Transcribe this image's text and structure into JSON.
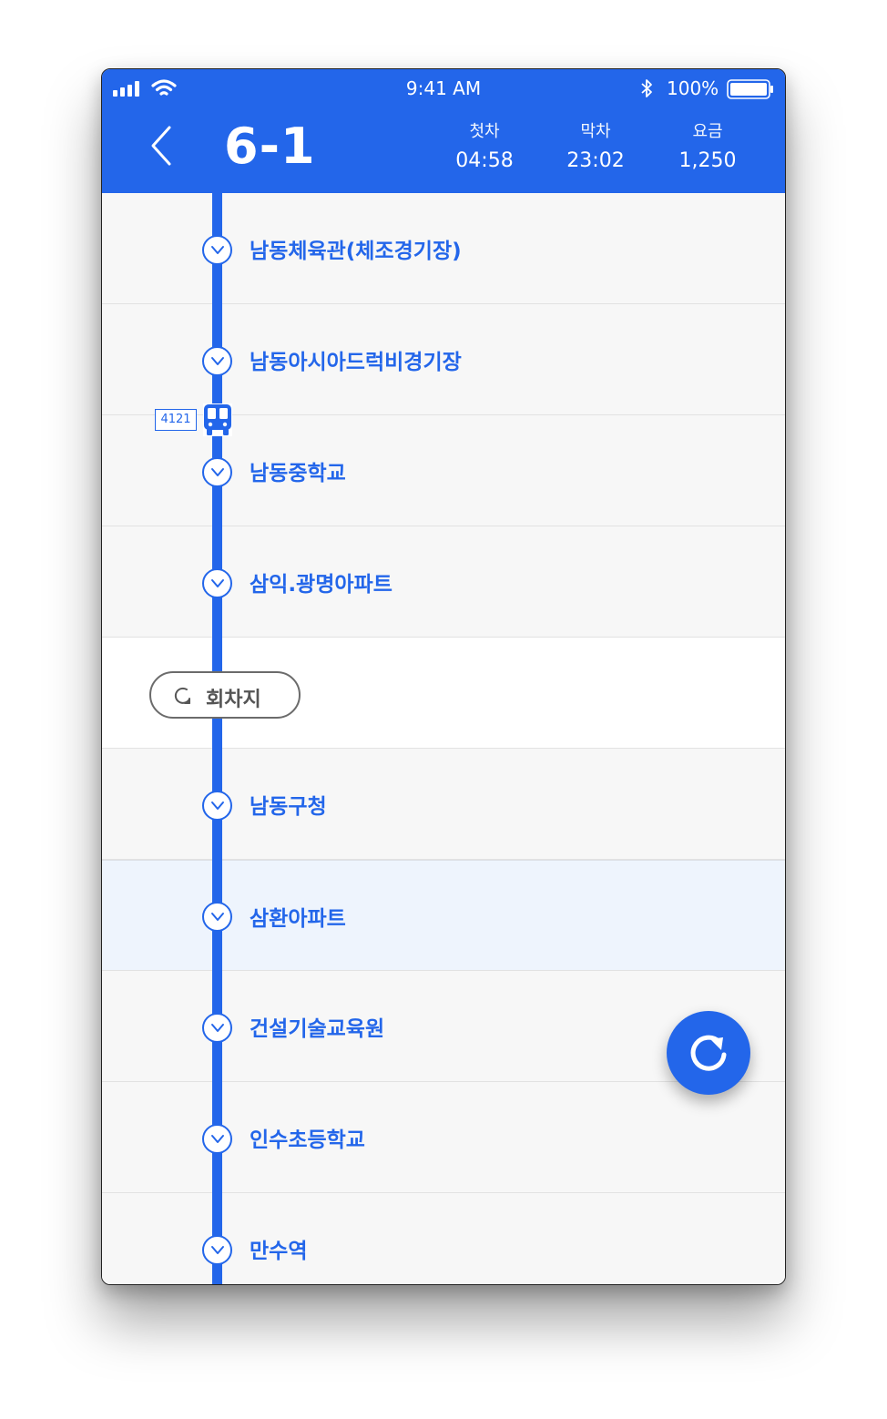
{
  "status_bar": {
    "time": "9:41 AM",
    "battery": "100%"
  },
  "header": {
    "route_number": "6-1",
    "info": [
      {
        "label": "첫차",
        "value": "04:58"
      },
      {
        "label": "막차",
        "value": "23:02"
      },
      {
        "label": "요금",
        "value": "1,250"
      }
    ]
  },
  "stops": [
    "남동체육관(체조경기장)",
    "남동아시아드럭비경기장",
    "남동중학교",
    "삼익.광명아파트",
    "남동구청",
    "삼환아파트",
    "건설기술교육원",
    "인수초등학교",
    "만수역"
  ],
  "bus": {
    "number": "4121"
  },
  "turnaround": {
    "label": "회차지"
  },
  "colors": {
    "brand": "#2366ea",
    "highlight": "#eef4fd"
  },
  "icons": {
    "back": "chevron-left-icon",
    "bus": "bus-icon",
    "stop": "chevron-down-icon",
    "turn": "u-turn-icon",
    "refresh": "refresh-icon"
  }
}
